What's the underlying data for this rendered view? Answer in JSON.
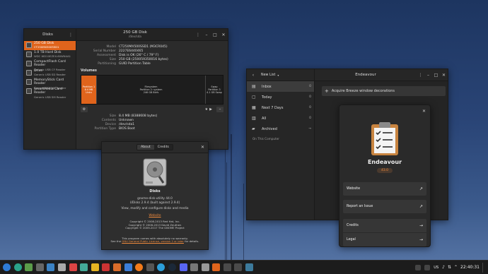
{
  "disks": {
    "title": "Disks",
    "window_title": "250 GB Disk",
    "window_subtitle": "/dev/sda",
    "devices": [
      {
        "name": "250 GB Disk",
        "model": "CT250MX500SSD1"
      },
      {
        "name": "1.0 TB Hard Disk",
        "model": "WDC WD10EZEX-60WN4A1"
      },
      {
        "name": "CompactFlash Card Reader",
        "model": "Generic USB  CF Reader"
      },
      {
        "name": "Drive",
        "model": "Generic USB  SD Reader"
      },
      {
        "name": "MemoryStick Card Reader",
        "model": "Generic USB  MS Reader"
      },
      {
        "name": "SmartMedia Card Reader",
        "model": "Generic USB  SM Reader"
      }
    ],
    "info": [
      {
        "k": "Model",
        "v": "CT250MX500SSD1 (M3CR045)"
      },
      {
        "k": "Serial Number",
        "v": "2227E6440465"
      },
      {
        "k": "Assessment",
        "v": "Disk is OK (26° C / 79° F)"
      },
      {
        "k": "Size",
        "v": "250 GB (250059350016 bytes)"
      },
      {
        "k": "Partitioning",
        "v": "GUID Partition Table"
      }
    ],
    "volumes_label": "Volumes",
    "partitions": [
      {
        "l1": "Partition 1",
        "l2": "8.4 MB Unkn"
      },
      {
        "l1": "Filesystem",
        "l2": "Partition 2: system",
        "l3": "246 GB Btrfs"
      },
      {
        "l1": "Swap",
        "l2": "Partition 3",
        "l3": "4.1 GB Swap"
      }
    ],
    "details": [
      {
        "k": "Size",
        "v": "8.4 MB (8388608 bytes)"
      },
      {
        "k": "Contents",
        "v": "Unknown"
      },
      {
        "k": "Device",
        "v": "/dev/sda1"
      },
      {
        "k": "Partition Type",
        "v": "BIOS Boot"
      }
    ]
  },
  "about": {
    "tabs": [
      "About",
      "Credits"
    ],
    "app_name": "Disks",
    "version": "gnome-disk-utility 44.0",
    "udisks": "UDisks 2.9.4 (built against 2.9.4)",
    "desc": "View, modify and configure disks and media",
    "website": "Website",
    "copyright": [
      "Copyright © 2008-2013 Red Hat, Inc.",
      "Copyright © 2008-2013 David Zeuthen",
      "Copyright © 2009-2017 The GNOME Project"
    ],
    "warranty1": "This program comes with absolutely no warranty.",
    "warranty2_pre": "See the ",
    "warranty2_link": "GNU General Public License, version 2 or later",
    "warranty2_post": " for details."
  },
  "endeavour": {
    "new_list": "New List",
    "title": "Endeavour",
    "lists": [
      {
        "label": "Inbox",
        "count": "0",
        "icon": "inbox-icon"
      },
      {
        "label": "Today",
        "count": "0",
        "icon": "today-icon"
      },
      {
        "label": "Next 7 Days",
        "count": "0",
        "icon": "calendar-icon"
      },
      {
        "label": "All",
        "count": "0",
        "icon": "all-icon"
      },
      {
        "label": "Archived",
        "count": "→",
        "icon": "folder-icon"
      }
    ],
    "section": "On This Computer",
    "new_task": "Acquire Breeze window decorations",
    "about": {
      "name": "Endeavour",
      "version": "43.0",
      "rows": [
        "Website",
        "Report an Issue",
        "Credits",
        "Legal"
      ]
    }
  },
  "taskbar": {
    "locale": "US",
    "time": "22:40:31",
    "accent": "#e0641c"
  }
}
